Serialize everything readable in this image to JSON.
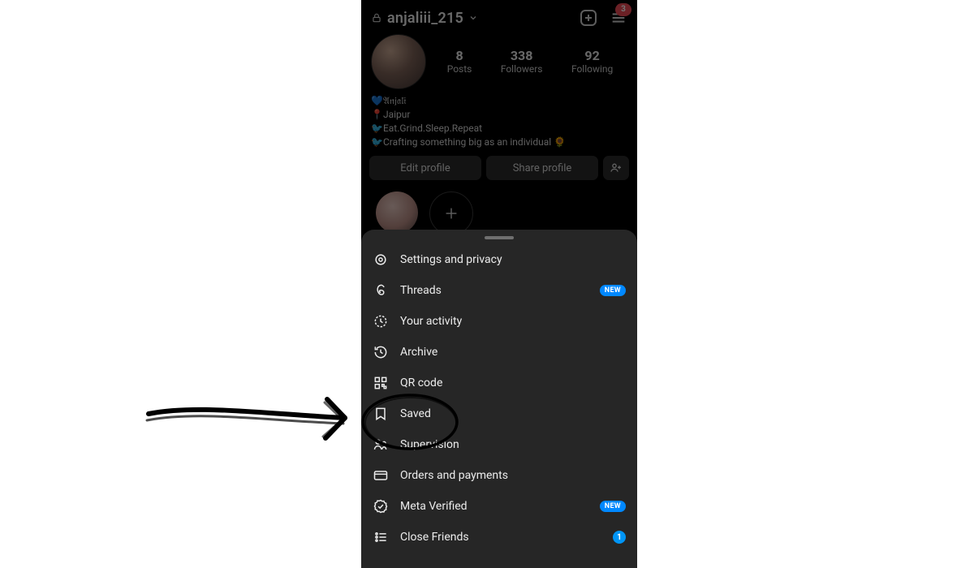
{
  "header": {
    "username": "anjaliii_215",
    "badge_count": "3"
  },
  "stats": {
    "posts_n": "8",
    "posts_l": "Posts",
    "followers_n": "338",
    "followers_l": "Followers",
    "following_n": "92",
    "following_l": "Following"
  },
  "bio": {
    "line1": "💙𝔄𝔫𝔧𝔞𝔩𝔦",
    "line2": "📍Jaipur",
    "line3": "🐦Eat.Grind.Sleep.Repeat",
    "line4": "🐦Crafting something big as an individual 🌻"
  },
  "buttons": {
    "edit": "Edit profile",
    "share": "Share profile"
  },
  "menu": {
    "new_label": "NEW",
    "close_friends_count": "1",
    "items": [
      {
        "label": "Settings and privacy"
      },
      {
        "label": "Threads"
      },
      {
        "label": "Your activity"
      },
      {
        "label": "Archive"
      },
      {
        "label": "QR code"
      },
      {
        "label": "Saved"
      },
      {
        "label": "Supervision"
      },
      {
        "label": "Orders and payments"
      },
      {
        "label": "Meta Verified"
      },
      {
        "label": "Close Friends"
      }
    ]
  }
}
